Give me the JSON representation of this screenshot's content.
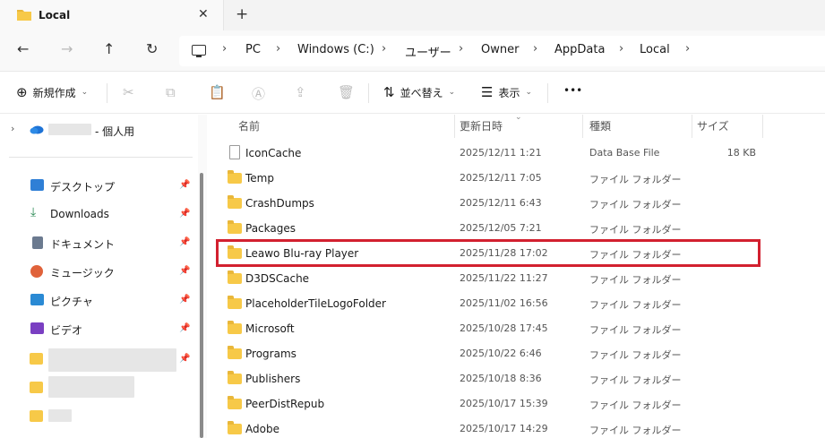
{
  "tab": {
    "title": "Local",
    "close_label": "✕",
    "new_tab_label": "+"
  },
  "nav": {
    "back": "←",
    "forward": "→",
    "up": "↑",
    "refresh": "↻"
  },
  "breadcrumb": [
    "PC",
    "Windows (C:)",
    "ユーザー",
    "Owner",
    "AppData",
    "Local"
  ],
  "commands": {
    "new": "新規作成",
    "sort": "並べ替え",
    "view": "表示",
    "more": "•••"
  },
  "sidebar": {
    "cloud_suffix": "- 個人用",
    "items": [
      {
        "label": "デスクトップ",
        "icon": "desktop-icon",
        "color": "#2f7fd6"
      },
      {
        "label": "Downloads",
        "icon": "download-icon",
        "color": "#2e8b57"
      },
      {
        "label": "ドキュメント",
        "icon": "document-icon",
        "color": "#6b7a8f"
      },
      {
        "label": "ミュージック",
        "icon": "music-icon",
        "color": "#e0623a"
      },
      {
        "label": "ピクチャ",
        "icon": "picture-icon",
        "color": "#2a8ad4"
      },
      {
        "label": "ビデオ",
        "icon": "video-icon",
        "color": "#7a3fc2"
      }
    ]
  },
  "columns": {
    "name": "名前",
    "date": "更新日時",
    "type": "種類",
    "size": "サイズ"
  },
  "files": [
    {
      "name": "IconCache",
      "date": "2025/12/11 1:21",
      "type": "Data Base File",
      "size": "18 KB",
      "kind": "file"
    },
    {
      "name": "Temp",
      "date": "2025/12/11 7:05",
      "type": "ファイル フォルダー",
      "size": "",
      "kind": "folder"
    },
    {
      "name": "CrashDumps",
      "date": "2025/12/11 6:43",
      "type": "ファイル フォルダー",
      "size": "",
      "kind": "folder"
    },
    {
      "name": "Packages",
      "date": "2025/12/05 7:21",
      "type": "ファイル フォルダー",
      "size": "",
      "kind": "folder"
    },
    {
      "name": "Leawo Blu-ray Player",
      "date": "2025/11/28 17:02",
      "type": "ファイル フォルダー",
      "size": "",
      "kind": "folder"
    },
    {
      "name": "D3DSCache",
      "date": "2025/11/22 11:27",
      "type": "ファイル フォルダー",
      "size": "",
      "kind": "folder"
    },
    {
      "name": "PlaceholderTileLogoFolder",
      "date": "2025/11/02 16:56",
      "type": "ファイル フォルダー",
      "size": "",
      "kind": "folder"
    },
    {
      "name": "Microsoft",
      "date": "2025/10/28 17:45",
      "type": "ファイル フォルダー",
      "size": "",
      "kind": "folder"
    },
    {
      "name": "Programs",
      "date": "2025/10/22 6:46",
      "type": "ファイル フォルダー",
      "size": "",
      "kind": "folder"
    },
    {
      "name": "Publishers",
      "date": "2025/10/18 8:36",
      "type": "ファイル フォルダー",
      "size": "",
      "kind": "folder"
    },
    {
      "name": "PeerDistRepub",
      "date": "2025/10/17 15:39",
      "type": "ファイル フォルダー",
      "size": "",
      "kind": "folder"
    },
    {
      "name": "Adobe",
      "date": "2025/10/17 14:29",
      "type": "ファイル フォルダー",
      "size": "",
      "kind": "folder"
    }
  ],
  "highlight_color": "#d2202f"
}
